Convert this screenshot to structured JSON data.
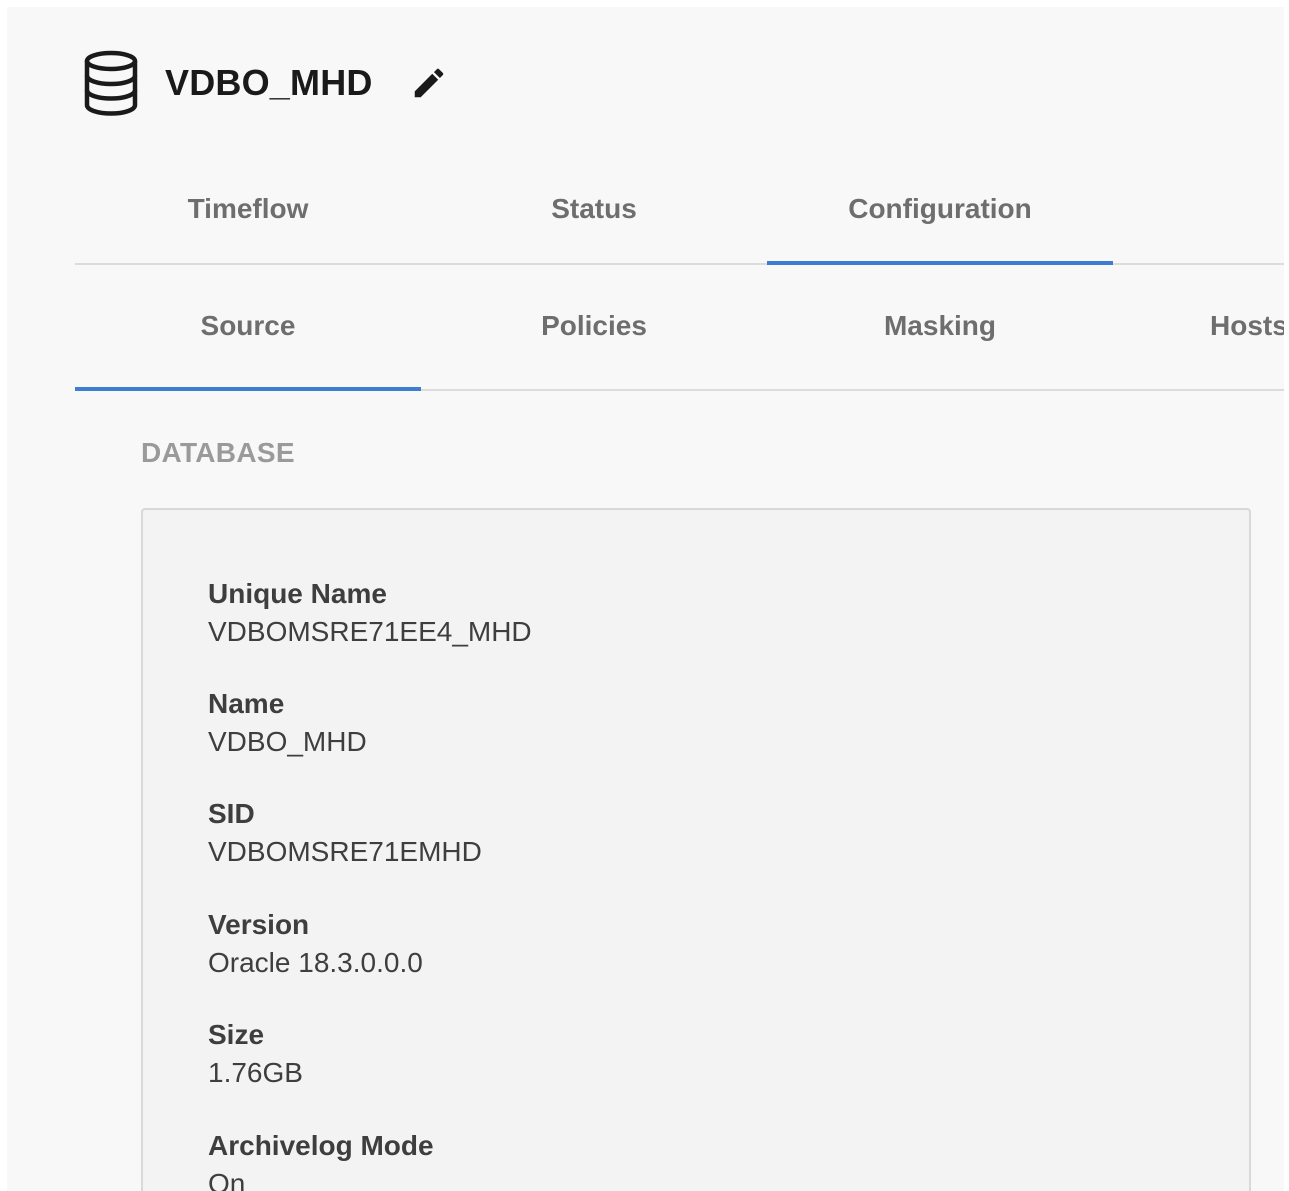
{
  "header": {
    "title": "VDBO_MHD",
    "db_icon": "database-icon",
    "edit_icon": "pencil-icon"
  },
  "primary_tabs": [
    {
      "label": "Timeflow",
      "active": false
    },
    {
      "label": "Status",
      "active": false
    },
    {
      "label": "Configuration",
      "active": true
    }
  ],
  "secondary_tabs": [
    {
      "label": "Source",
      "active": true
    },
    {
      "label": "Policies",
      "active": false
    },
    {
      "label": "Masking",
      "active": false
    },
    {
      "label": "Hosts",
      "active": false
    }
  ],
  "section": {
    "title": "DATABASE"
  },
  "fields": [
    {
      "label": "Unique Name",
      "value": "VDBOMSRE71EE4_MHD"
    },
    {
      "label": "Name",
      "value": "VDBO_MHD"
    },
    {
      "label": "SID",
      "value": "VDBOMSRE71EMHD"
    },
    {
      "label": "Version",
      "value": "Oracle 18.3.0.0.0"
    },
    {
      "label": "Size",
      "value": "1.76GB"
    },
    {
      "label": "Archivelog Mode",
      "value": "On"
    }
  ],
  "colors": {
    "accent": "#3d7ed1",
    "tab_text": "#6e6e6e",
    "section_label": "#9a9a9a"
  }
}
